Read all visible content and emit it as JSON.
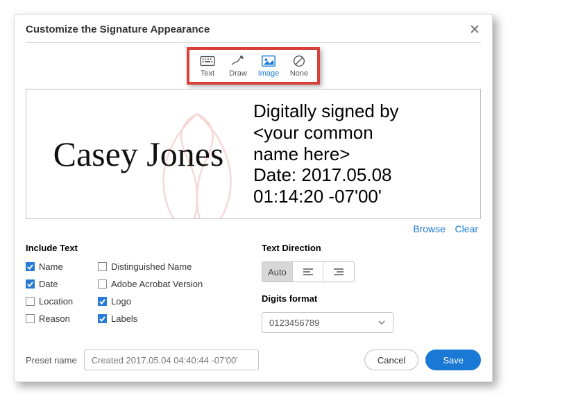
{
  "dialog": {
    "title": "Customize the Signature Appearance"
  },
  "modes": {
    "text": "Text",
    "draw": "Draw",
    "image": "Image",
    "none": "None",
    "selected": "Image"
  },
  "preview": {
    "signature_name": "Casey Jones",
    "details_line1": "Digitally signed by",
    "details_line2": "<your common",
    "details_line3": "name here>",
    "details_line4": "Date: 2017.05.08",
    "details_line5": "01:14:20 -07'00'"
  },
  "links": {
    "browse": "Browse",
    "clear": "Clear"
  },
  "include_text": {
    "heading": "Include Text",
    "name": {
      "label": "Name",
      "checked": true
    },
    "date": {
      "label": "Date",
      "checked": true
    },
    "location": {
      "label": "Location",
      "checked": false
    },
    "reason": {
      "label": "Reason",
      "checked": false
    },
    "dn": {
      "label": "Distinguished Name",
      "checked": false
    },
    "version": {
      "label": "Adobe Acrobat Version",
      "checked": false
    },
    "logo": {
      "label": "Logo",
      "checked": true
    },
    "labels": {
      "label": "Labels",
      "checked": true
    }
  },
  "text_direction": {
    "heading": "Text Direction",
    "auto": "Auto"
  },
  "digits": {
    "heading": "Digits format",
    "value": "0123456789"
  },
  "preset": {
    "label": "Preset name",
    "value": "Created 2017.05.04 04:40:44 -07'00'"
  },
  "buttons": {
    "cancel": "Cancel",
    "save": "Save"
  }
}
